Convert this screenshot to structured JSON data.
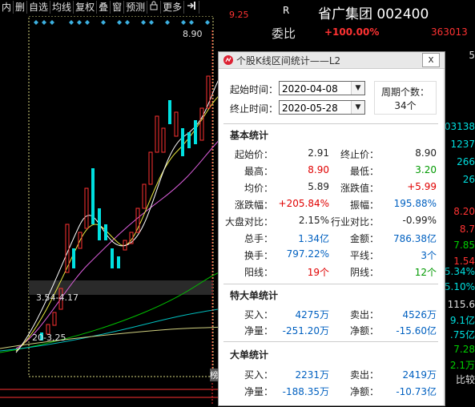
{
  "toolbar": {
    "items": [
      "内",
      "删",
      "自选",
      "均线",
      "复权",
      "叠",
      "窗",
      "预测",
      "更多"
    ]
  },
  "chart": {
    "price_top": "9.25",
    "label_high": "8.90",
    "label_range": "3.54-4.17",
    "label_range2": "20-3.25",
    "label_bottom": "榜"
  },
  "right": {
    "r": "R",
    "title": "省广集团 002400",
    "weibi_label": "委比",
    "weibi_pct": "+100.00%",
    "weibi_num": "363013",
    "side": [
      {
        "v": "5",
        "c": "white"
      },
      {
        "v": "03138",
        "c": "cyan"
      },
      {
        "v": "1237",
        "c": "cyan"
      },
      {
        "v": "266",
        "c": "cyan"
      },
      {
        "v": "26",
        "c": "cyan"
      },
      {
        "v": "8.20",
        "c": "red"
      },
      {
        "v": "8.7",
        "c": "red"
      },
      {
        "v": "7.85",
        "c": "green"
      },
      {
        "v": "1.54",
        "c": "red"
      },
      {
        "v": "5.34%",
        "c": "cyan"
      },
      {
        "v": "5.10%",
        "c": "cyan"
      },
      {
        "v": "115.6",
        "c": "white"
      },
      {
        "v": "9.1亿",
        "c": "cyan"
      },
      {
        "v": ".75亿",
        "c": "cyan"
      },
      {
        "v": "7.28",
        "c": "green"
      },
      {
        "v": "2.1万",
        "c": "green"
      },
      {
        "v": "比较",
        "c": "white"
      }
    ]
  },
  "dialog": {
    "title": "个股K线区间统计——L2",
    "close": "x",
    "start_label": "起始时间：",
    "start_value": "2020-04-08",
    "end_label": "终止时间：",
    "end_value": "2020-05-28",
    "cycle_label": "周期个数：",
    "cycle_value": "34个",
    "basic_title": "基本统计",
    "basic": [
      {
        "k1": "起始价：",
        "v1": "2.91",
        "c1": "black",
        "k2": "终止价：",
        "v2": "8.90",
        "c2": "black"
      },
      {
        "k1": "最高：",
        "v1": "8.90",
        "c1": "red",
        "k2": "最低：",
        "v2": "3.20",
        "c2": "green"
      },
      {
        "k1": "均价：",
        "v1": "5.89",
        "c1": "black",
        "k2": "涨跌值：",
        "v2": "+5.99",
        "c2": "red"
      },
      {
        "k1": "涨跌幅：",
        "v1": "+205.84%",
        "c1": "red",
        "k2": "振幅：",
        "v2": "195.88%",
        "c2": "blue"
      },
      {
        "k1": "大盘对比：",
        "v1": "2.15%",
        "c1": "black",
        "k2": "行业对比：",
        "v2": "-0.99%",
        "c2": "black"
      },
      {
        "k1": "总手：",
        "v1": "1.34亿",
        "c1": "blue",
        "k2": "金额：",
        "v2": "786.38亿",
        "c2": "blue"
      },
      {
        "k1": "换手：",
        "v1": "797.22%",
        "c1": "blue",
        "k2": "平线：",
        "v2": "3个",
        "c2": "blue"
      },
      {
        "k1": "阳线：",
        "v1": "19个",
        "c1": "red",
        "k2": "阴线：",
        "v2": "12个",
        "c2": "green"
      }
    ],
    "big_title": "特大单统计",
    "big": [
      {
        "k1": "买入：",
        "v1": "4275万",
        "c1": "blue",
        "k2": "卖出：",
        "v2": "4526万",
        "c2": "blue"
      },
      {
        "k1": "净量：",
        "v1": "-251.20万",
        "c1": "blue",
        "k2": "净额：",
        "v2": "-15.60亿",
        "c2": "blue"
      }
    ],
    "large_title": "大单统计",
    "large": [
      {
        "k1": "买入：",
        "v1": "2231万",
        "c1": "blue",
        "k2": "卖出：",
        "v2": "2419万",
        "c2": "blue"
      },
      {
        "k1": "净量：",
        "v1": "-188.35万",
        "c1": "blue",
        "k2": "净额：",
        "v2": "-10.73亿",
        "c2": "blue"
      }
    ]
  }
}
